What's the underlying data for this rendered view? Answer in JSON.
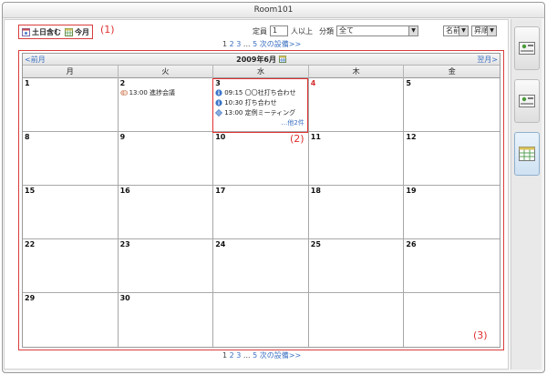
{
  "window": {
    "title": "Room101"
  },
  "toolbar": {
    "include_weekend_label": "土日含む",
    "this_month_label": "今月",
    "capacity_label": "定員",
    "capacity_value": "1",
    "capacity_suffix": "人以上",
    "category_label": "分類",
    "category_value": "全て",
    "sort_field": "名前",
    "sort_order": "昇順"
  },
  "pager": {
    "pages": [
      "1",
      "2",
      "3",
      "...",
      "5"
    ],
    "next_label": "次の設備>>"
  },
  "calendar": {
    "prev_label": "<前月",
    "next_label": "翌月>",
    "month_label": "2009年6月",
    "weekdays": [
      "月",
      "火",
      "水",
      "木",
      "金"
    ],
    "cells": [
      {
        "day": "1",
        "events": []
      },
      {
        "day": "2",
        "events": [
          {
            "text": "13:00 進捗会議",
            "icon": "memo-icon"
          }
        ]
      },
      {
        "day": "3",
        "events": [
          {
            "text": "09:15 〇〇社打ち合わせ",
            "icon": "info-icon"
          },
          {
            "text": "10:30 打ち合わせ",
            "icon": "info-icon"
          },
          {
            "text": "13:00 定例ミーティング",
            "icon": "diamond-icon"
          }
        ],
        "more": "…他2件"
      },
      {
        "day": "4",
        "events": []
      },
      {
        "day": "5",
        "events": []
      },
      {
        "day": "8",
        "events": []
      },
      {
        "day": "9",
        "events": []
      },
      {
        "day": "10",
        "events": []
      },
      {
        "day": "11",
        "events": []
      },
      {
        "day": "12",
        "events": []
      },
      {
        "day": "15",
        "events": []
      },
      {
        "day": "16",
        "events": []
      },
      {
        "day": "17",
        "events": []
      },
      {
        "day": "18",
        "events": []
      },
      {
        "day": "19",
        "events": []
      },
      {
        "day": "22",
        "events": []
      },
      {
        "day": "23",
        "events": []
      },
      {
        "day": "24",
        "events": []
      },
      {
        "day": "25",
        "events": []
      },
      {
        "day": "26",
        "events": []
      },
      {
        "day": "29",
        "events": []
      },
      {
        "day": "30",
        "events": []
      },
      {
        "day": "",
        "events": []
      },
      {
        "day": "",
        "events": []
      },
      {
        "day": "",
        "events": []
      }
    ]
  },
  "callouts": {
    "c1": "(1)",
    "c2": "(2)",
    "c3": "(3)"
  },
  "rail": {
    "buttons": [
      "room-view-icon",
      "room-view-icon",
      "month-grid-icon"
    ]
  },
  "colors": {
    "highlight": "#e03030",
    "link": "#3a6fc0",
    "accent_today": "#d43030"
  }
}
